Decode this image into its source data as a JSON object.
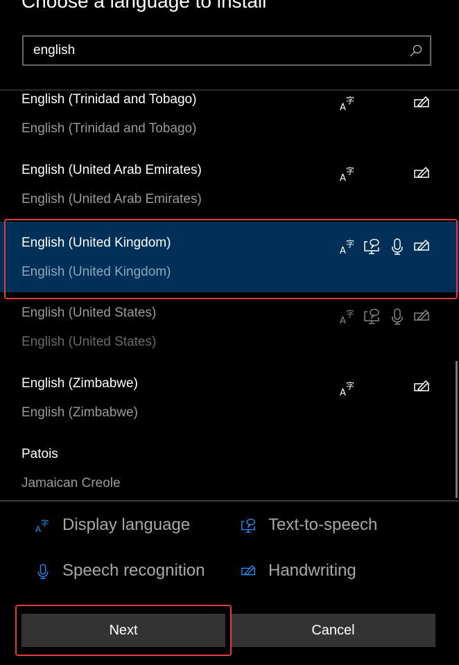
{
  "dialog": {
    "title": "Choose a language to install"
  },
  "search": {
    "value": "english",
    "icon": "search-icon"
  },
  "languages": [
    {
      "name": "English (Trinidad and Tobago)",
      "native": "English (Trinidad and Tobago)",
      "features": [
        "display-language",
        "handwriting"
      ],
      "state": "normal"
    },
    {
      "name": "English (United Arab Emirates)",
      "native": "English (United Arab Emirates)",
      "features": [
        "display-language",
        "handwriting"
      ],
      "state": "normal"
    },
    {
      "name": "English (United Kingdom)",
      "native": "English (United Kingdom)",
      "features": [
        "display-language",
        "text-to-speech",
        "speech-recognition",
        "handwriting"
      ],
      "state": "selected"
    },
    {
      "name": "English (United States)",
      "native": "English (United States)",
      "features": [
        "display-language",
        "text-to-speech",
        "speech-recognition",
        "handwriting"
      ],
      "state": "disabled"
    },
    {
      "name": "English (Zimbabwe)",
      "native": "English (Zimbabwe)",
      "features": [
        "display-language",
        "handwriting"
      ],
      "state": "normal"
    },
    {
      "name": "Patois",
      "native": "Jamaican Creole",
      "features": [],
      "state": "normal"
    }
  ],
  "legend": {
    "display_language": "Display language",
    "text_to_speech": "Text-to-speech",
    "speech_recognition": "Speech recognition",
    "handwriting": "Handwriting"
  },
  "buttons": {
    "next": "Next",
    "cancel": "Cancel"
  },
  "colors": {
    "background": "#000000",
    "selected_row": "#003058",
    "accent_icon": "#1e90ff",
    "highlight_outline": "#e53b3b",
    "button_bg": "#333333"
  }
}
